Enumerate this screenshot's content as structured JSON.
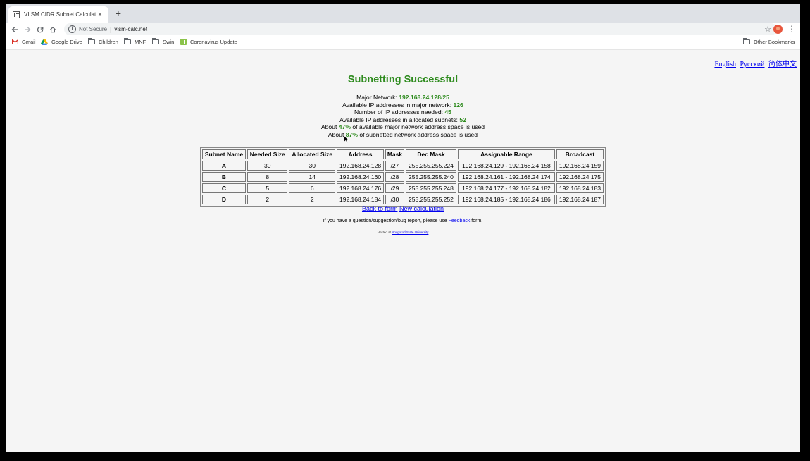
{
  "browser": {
    "tab_title": "VLSM CIDR Subnet Calculator",
    "tab_close": "×",
    "new_tab": "+",
    "security_label": "Not Secure",
    "url_separator": "|",
    "url": "vlsm-calc.net",
    "bookmarks": [
      "Gmail",
      "Google Drive",
      "Children",
      "MNF",
      "Swin",
      "Coronavirus Update"
    ],
    "other_bookmarks": "Other Bookmarks"
  },
  "page": {
    "languages": [
      "English",
      "Русский",
      "简体中文"
    ],
    "title": "Subnetting Successful",
    "summary": {
      "major_network_label": "Major Network:",
      "major_network": "192.168.24.128/25",
      "available_label": "Available IP addresses in major network:",
      "available": "126",
      "needed_label": "Number of IP addresses needed:",
      "needed": "45",
      "allocated_label": "Available IP addresses in allocated subnets:",
      "allocated": "52",
      "major_used_prefix": "About",
      "major_used": "47%",
      "major_used_suffix": "of available major network address space is used",
      "subnetted_used_prefix": "About",
      "subnetted_used": "87%",
      "subnetted_used_suffix": "of subnetted network address space is used"
    },
    "table": {
      "headers": [
        "Subnet Name",
        "Needed Size",
        "Allocated Size",
        "Address",
        "Mask",
        "Dec Mask",
        "Assignable Range",
        "Broadcast"
      ],
      "rows": [
        [
          "A",
          "30",
          "30",
          "192.168.24.128",
          "/27",
          "255.255.255.224",
          "192.168.24.129 - 192.168.24.158",
          "192.168.24.159"
        ],
        [
          "B",
          "8",
          "14",
          "192.168.24.160",
          "/28",
          "255.255.255.240",
          "192.168.24.161 - 192.168.24.174",
          "192.168.24.175"
        ],
        [
          "C",
          "5",
          "6",
          "192.168.24.176",
          "/29",
          "255.255.255.248",
          "192.168.24.177 - 192.168.24.182",
          "192.168.24.183"
        ],
        [
          "D",
          "2",
          "2",
          "192.168.24.184",
          "/30",
          "255.255.255.252",
          "192.168.24.185 - 192.168.24.186",
          "192.168.24.187"
        ]
      ]
    },
    "back_to_form": "Back to form",
    "new_calculation": "New calculation",
    "feedback_prefix": "If you have a question/suggestion/bug report, please use",
    "feedback_link": "Feedback",
    "feedback_suffix": "form.",
    "hosted_prefix": "Hosted at",
    "hosted_link": "Novgorod State University"
  }
}
